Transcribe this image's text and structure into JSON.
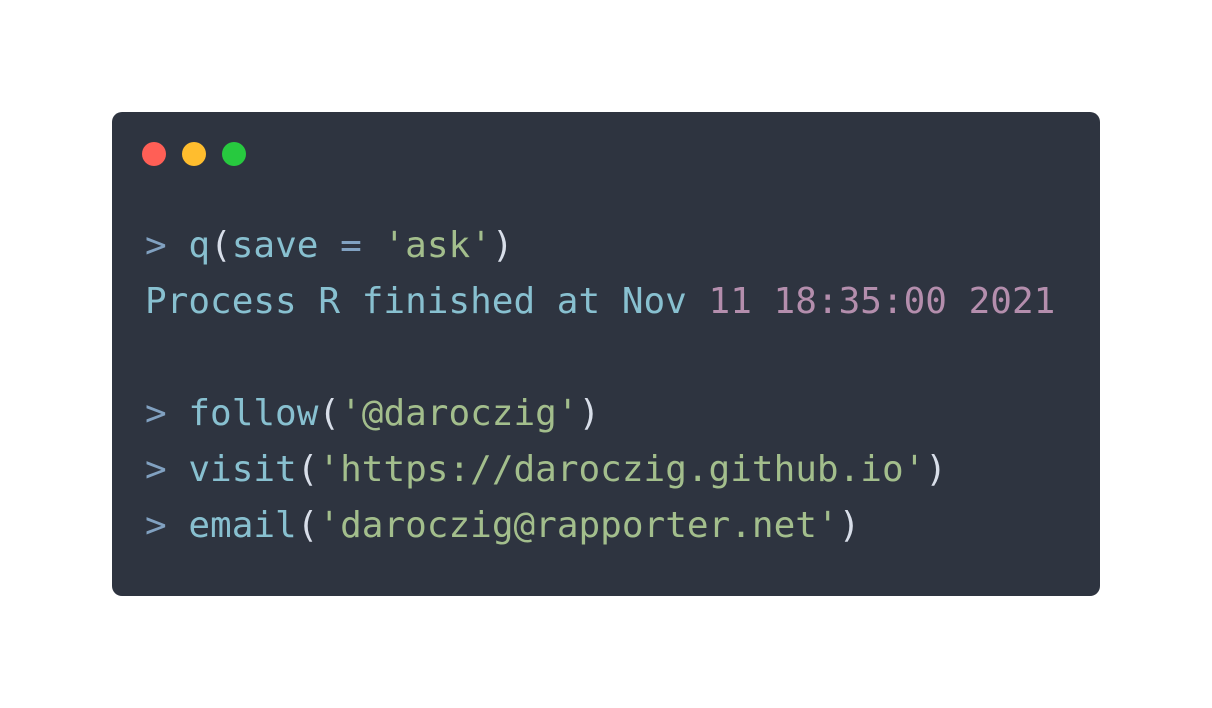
{
  "window": {
    "controls": [
      {
        "name": "close",
        "color": "#ff5f56"
      },
      {
        "name": "minimize",
        "color": "#ffbd2e"
      },
      {
        "name": "maximize",
        "color": "#27c93f"
      }
    ]
  },
  "colors": {
    "background": "#2e3440",
    "prompt": "#81a1c1",
    "function": "#88c0d0",
    "string": "#a3be8c",
    "punctuation": "#d8dee9",
    "number": "#b48ead"
  },
  "code": {
    "lines": [
      [
        {
          "t": "> ",
          "c": "prompt"
        },
        {
          "t": "q",
          "c": "function"
        },
        {
          "t": "(",
          "c": "punctuation"
        },
        {
          "t": "save ",
          "c": "function"
        },
        {
          "t": "=",
          "c": "prompt"
        },
        {
          "t": " ",
          "c": "punctuation"
        },
        {
          "t": "'ask'",
          "c": "string"
        },
        {
          "t": ")",
          "c": "punctuation"
        }
      ],
      [
        {
          "t": "Process R finished at Nov ",
          "c": "function"
        },
        {
          "t": "11 18:35:00 2021",
          "c": "number"
        }
      ],
      [],
      [
        {
          "t": "> ",
          "c": "prompt"
        },
        {
          "t": "follow",
          "c": "function"
        },
        {
          "t": "(",
          "c": "punctuation"
        },
        {
          "t": "'@daroczig'",
          "c": "string"
        },
        {
          "t": ")",
          "c": "punctuation"
        }
      ],
      [
        {
          "t": "> ",
          "c": "prompt"
        },
        {
          "t": "visit",
          "c": "function"
        },
        {
          "t": "(",
          "c": "punctuation"
        },
        {
          "t": "'https://daroczig.github.io'",
          "c": "string"
        },
        {
          "t": ")",
          "c": "punctuation"
        }
      ],
      [
        {
          "t": "> ",
          "c": "prompt"
        },
        {
          "t": "email",
          "c": "function"
        },
        {
          "t": "(",
          "c": "punctuation"
        },
        {
          "t": "'daroczig@rapporter.net'",
          "c": "string"
        },
        {
          "t": ")",
          "c": "punctuation"
        }
      ]
    ]
  }
}
